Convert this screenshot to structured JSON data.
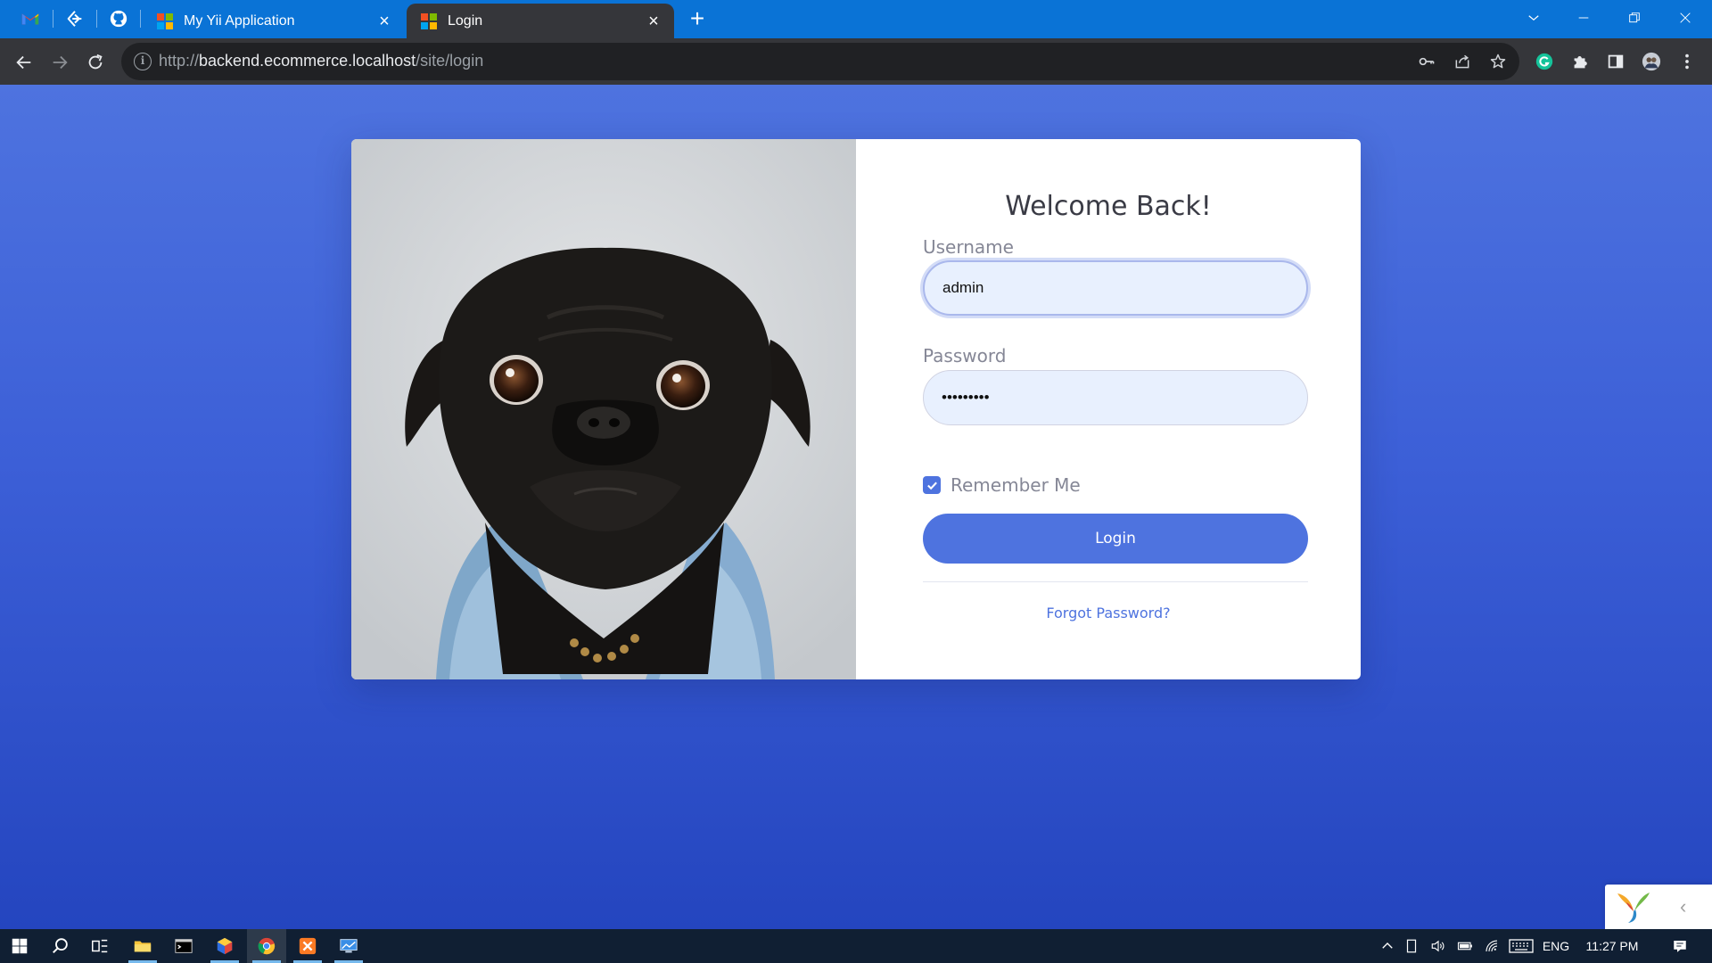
{
  "browser": {
    "pinned_tabs": [
      {
        "icon": "gmail-icon"
      },
      {
        "icon": "edge-e-icon"
      },
      {
        "icon": "github-icon"
      }
    ],
    "tabs": [
      {
        "title": "My Yii Application",
        "active": false
      },
      {
        "title": "Login",
        "active": true
      }
    ],
    "new_tab_label": "+",
    "url": {
      "scheme": "http://",
      "host": "backend.ecommerce.localhost",
      "path": "/site/login"
    }
  },
  "login": {
    "heading": "Welcome Back!",
    "username_label": "Username",
    "username_value": "admin",
    "password_label": "Password",
    "password_value": "•••••••••",
    "remember_label": "Remember Me",
    "remember_checked": true,
    "login_button": "Login",
    "forgot_link": "Forgot Password?"
  },
  "taskbar": {
    "language": "ENG",
    "time": "11:27 PM"
  },
  "colors": {
    "primary": "#4e73df",
    "page_gradient_top": "#4e73df",
    "page_gradient_bottom": "#2445bf",
    "chrome_tab_bar": "#0a73d6",
    "toolbar": "#35363a",
    "taskbar": "#101f33"
  }
}
